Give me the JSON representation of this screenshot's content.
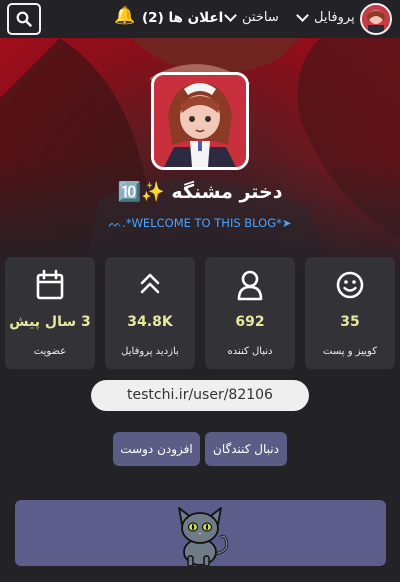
{
  "header": {
    "search_icon": "search-icon",
    "bell_icon": "bell-icon",
    "announcements_label": "اعلان ها (2)",
    "build_label": "ساختن",
    "profile_label": "پروفایل"
  },
  "profile": {
    "name": "دختر مشنگه ✨🔟",
    "welcome": "ᨓ.*WELCOME TO THIS BLOG*➤"
  },
  "stats": [
    {
      "icon": "calendar-icon",
      "value": "3 سال پیش",
      "label": "عضویت"
    },
    {
      "icon": "double-chevron-up-icon",
      "value": "34.8K",
      "label": "بازدید پروفایل"
    },
    {
      "icon": "user-icon",
      "value": "692",
      "label": "دنبال کننده"
    },
    {
      "icon": "smiley-icon",
      "value": "35",
      "label": "کوییز و پست"
    }
  ],
  "url": "testchi.ir/user/82106",
  "buttons": {
    "followers": "دنبال کنندگان",
    "add_friend": "افزودن دوست"
  },
  "colors": {
    "accent_value": "#e7e8a0",
    "button_bg": "#5c5d86",
    "background": "#222227",
    "card_bg": "#323237",
    "welcome_text": "#4aa3ff"
  }
}
